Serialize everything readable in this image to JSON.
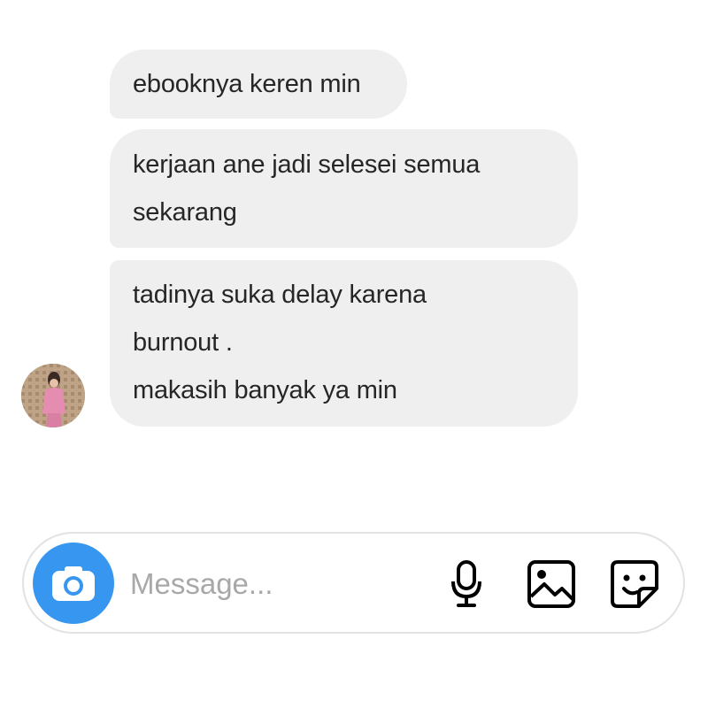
{
  "messages": [
    {
      "lines": [
        "ebooknya keren min"
      ]
    },
    {
      "lines": [
        "kerjaan ane jadi selesei semua",
        "sekarang"
      ]
    },
    {
      "lines": [
        "tadinya suka delay karena",
        "burnout .",
        "makasih banyak ya min"
      ]
    }
  ],
  "composer": {
    "placeholder": "Message...",
    "camera_icon": "camera-icon",
    "mic_icon": "microphone-icon",
    "gallery_icon": "image-icon",
    "sticker_icon": "sticker-icon"
  },
  "colors": {
    "bubble": "#efefef",
    "text": "#262626",
    "accent": "#3797f0",
    "placeholder": "#a8a8a8"
  }
}
